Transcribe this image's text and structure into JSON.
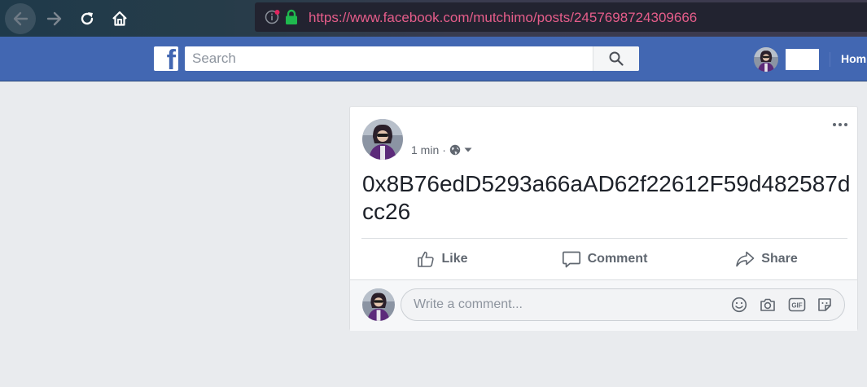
{
  "browser": {
    "url": "https://www.facebook.com/mutchimo/posts/2457698724309666",
    "icons": [
      "back-icon",
      "forward-icon",
      "reload-icon",
      "home-icon",
      "site-info-icon",
      "lock-icon"
    ]
  },
  "header": {
    "logo": "f",
    "search_placeholder": "Search",
    "home_label": "Hom"
  },
  "post": {
    "time": "1 min",
    "separator": "·",
    "text": "0x8B76edD5293a66aAD62f22612F59d482587dcc26",
    "actions": {
      "like": "Like",
      "comment": "Comment",
      "share": "Share"
    },
    "comment_placeholder": "Write a comment...",
    "comment_tools": [
      "emoji-icon",
      "camera-icon",
      "gif-icon",
      "sticker-icon"
    ]
  },
  "colors": {
    "fb_blue": "#4267b2",
    "url_text": "#e65d8a",
    "lock_green": "#1fb94e",
    "page_bg": "#e9ebee"
  }
}
